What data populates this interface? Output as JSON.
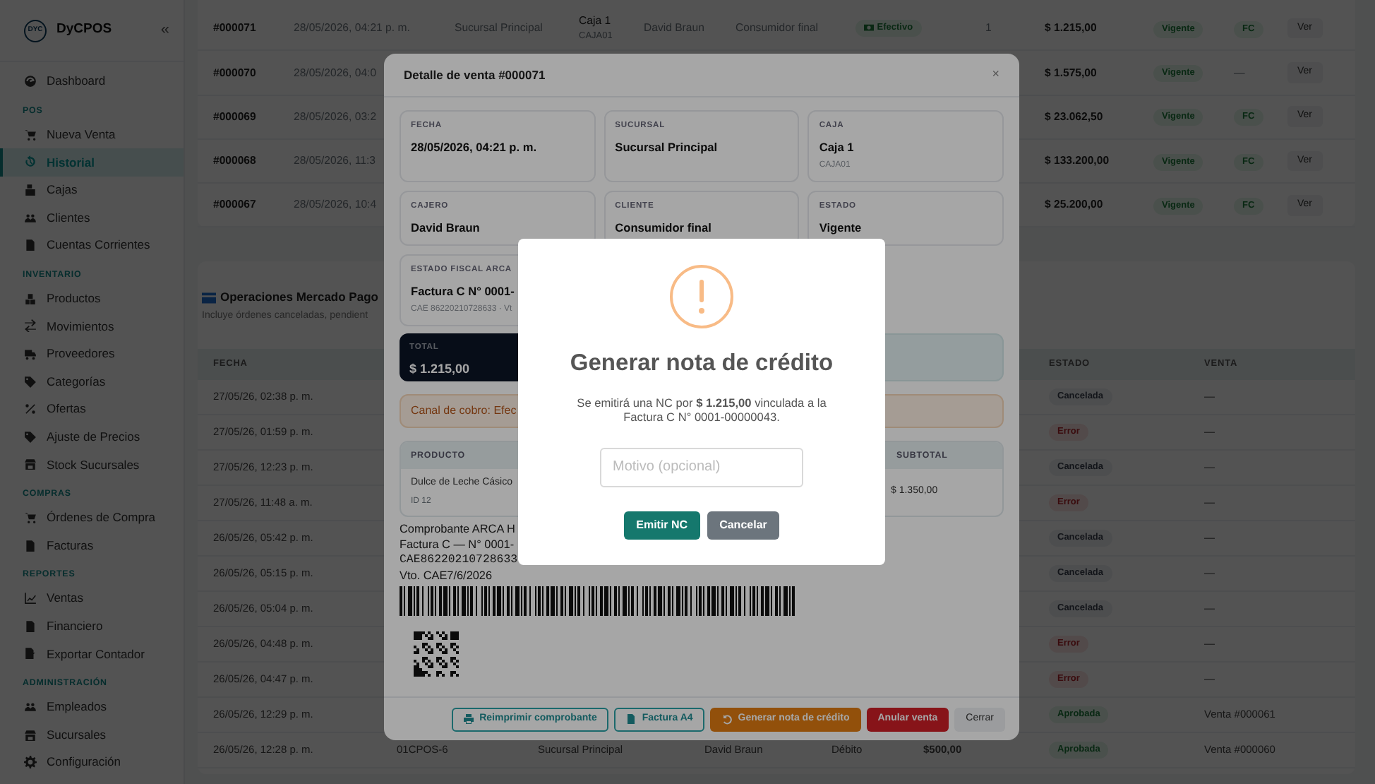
{
  "sidebar": {
    "brand": "DyCPOS",
    "logo_text": "DYC",
    "collapse": "«",
    "sections": [
      {
        "items": [
          {
            "label": "Dashboard",
            "selected": false
          }
        ]
      },
      {
        "title": "POS",
        "items": [
          {
            "label": "Nueva Venta",
            "selected": false
          },
          {
            "label": "Historial",
            "selected": true
          },
          {
            "label": "Cajas",
            "selected": false
          },
          {
            "label": "Clientes",
            "selected": false
          },
          {
            "label": "Cuentas Corrientes",
            "selected": false
          }
        ]
      },
      {
        "title": "INVENTARIO",
        "items": [
          {
            "label": "Productos",
            "selected": false
          },
          {
            "label": "Movimientos",
            "selected": false
          },
          {
            "label": "Proveedores",
            "selected": false
          },
          {
            "label": "Categorías",
            "selected": false
          },
          {
            "label": "Ofertas",
            "selected": false
          },
          {
            "label": "Ajuste de Precios",
            "selected": false
          },
          {
            "label": "Stock Sucursales",
            "selected": false
          }
        ]
      },
      {
        "title": "COMPRAS",
        "items": [
          {
            "label": "Órdenes de Compra",
            "selected": false
          },
          {
            "label": "Facturas",
            "selected": false
          }
        ]
      },
      {
        "title": "REPORTES",
        "items": [
          {
            "label": "Ventas",
            "selected": false
          },
          {
            "label": "Financiero",
            "selected": false
          },
          {
            "label": "Exportar Contador",
            "selected": false
          }
        ]
      },
      {
        "title": "ADMINISTRACIÓN",
        "items": [
          {
            "label": "Empleados",
            "selected": false
          },
          {
            "label": "Sucursales",
            "selected": false
          },
          {
            "label": "Configuración",
            "selected": false
          }
        ]
      }
    ]
  },
  "sales_table": {
    "rows": [
      {
        "id": "#000071",
        "date": "28/05/2026, 04:21 p. m.",
        "branch": "Sucursal Principal",
        "register": "Caja 1",
        "register_code": "CAJA01",
        "cashier": "David Braun",
        "customer": "Consumidor final",
        "payment": "Efectivo",
        "items": "1",
        "total": "$ 1.215,00",
        "status": "Vigente",
        "invoice": {
          "label": "FC",
          "kind": "badge"
        },
        "action": "Ver"
      },
      {
        "id": "#000070",
        "date": "28/05/2026, 04:0",
        "total": "$ 1.575,00",
        "status": "Vigente",
        "invoice": {
          "label": "—",
          "kind": "plain"
        },
        "action": "Ver"
      },
      {
        "id": "#000069",
        "date": "28/05/2026, 03:2",
        "total": "$ 23.062,50",
        "status": "Vigente",
        "invoice": {
          "label": "FC",
          "kind": "badge"
        },
        "action": "Ver"
      },
      {
        "id": "#000068",
        "date": "28/05/2026, 11:3",
        "total": "$ 133.200,00",
        "status": "Vigente",
        "invoice": {
          "label": "FC",
          "kind": "badge"
        },
        "action": "Ver"
      },
      {
        "id": "#000067",
        "date": "28/05/2026, 10:4",
        "total": "$ 25.200,00",
        "status": "Vigente",
        "invoice": {
          "label": "FC",
          "kind": "badge"
        },
        "action": "Ver"
      }
    ]
  },
  "mp_operations": {
    "title": "Operaciones Mercado Pago",
    "subtitle": "Incluye órdenes canceladas, pendient",
    "columns": {
      "date": "FECHA",
      "status": "ESTADO",
      "sale": "VENTA"
    },
    "rows": [
      {
        "date": "27/05/26, 02:38 p. m.",
        "status": {
          "label": "Cancelada",
          "kind": "cancelled"
        },
        "sale": "—"
      },
      {
        "date": "27/05/26, 01:59 p. m.",
        "status": {
          "label": "Error",
          "kind": "error"
        },
        "sale": "—"
      },
      {
        "date": "27/05/26, 12:23 p. m.",
        "status": {
          "label": "Cancelada",
          "kind": "cancelled"
        },
        "sale": "—"
      },
      {
        "date": "27/05/26, 11:48 a. m.",
        "status": {
          "label": "Error",
          "kind": "error"
        },
        "sale": "—"
      },
      {
        "date": "26/05/26, 05:42 p. m.",
        "status": {
          "label": "Cancelada",
          "kind": "cancelled"
        },
        "sale": "—"
      },
      {
        "date": "26/05/26, 05:15 p. m.",
        "status": {
          "label": "Cancelada",
          "kind": "cancelled"
        },
        "sale": "—"
      },
      {
        "date": "26/05/26, 05:04 p. m.",
        "status": {
          "label": "Cancelada",
          "kind": "cancelled"
        },
        "sale": "—"
      },
      {
        "date": "26/05/26, 04:48 p. m.",
        "status": {
          "label": "Error",
          "kind": "error"
        },
        "sale": "—"
      },
      {
        "date": "26/05/26, 04:47 p. m.",
        "status": {
          "label": "Error",
          "kind": "error"
        },
        "sale": "—"
      },
      {
        "date": "26/05/26, 12:29 p. m.",
        "status": {
          "label": "Aprobada",
          "kind": "approved"
        },
        "sale": "Venta #000061"
      },
      {
        "date": "26/05/26, 12:28 p. m.",
        "reference": "01CPOS-6",
        "branch": "Sucursal Principal",
        "cashier": "David Braun",
        "method": "Débito",
        "amount": "$500,00",
        "status": {
          "label": "Aprobada",
          "kind": "approved"
        },
        "sale": "Venta #000060"
      }
    ]
  },
  "sale_detail_modal": {
    "title": "Detalle de venta #000071",
    "close": "×",
    "fields": [
      {
        "label": "FECHA",
        "value": "28/05/2026, 04:21 p. m."
      },
      {
        "label": "SUCURSAL",
        "value": "Sucursal Principal"
      },
      {
        "label": "CAJA",
        "value": "Caja 1",
        "sub": "CAJA01"
      },
      {
        "label": "CAJERO",
        "value": "David Braun"
      },
      {
        "label": "CLIENTE",
        "value": "Consumidor final"
      },
      {
        "label": "ESTADO",
        "value": "Vigente"
      },
      {
        "label": "ESTADO FISCAL ARCA",
        "value": "Factura C N° 0001-",
        "sub": "CAE 86220210728633 · Vt"
      }
    ],
    "total": {
      "label": "TOTAL",
      "value": "$ 1.215,00"
    },
    "payment_alert": "Canal de cobro: Efec",
    "products": {
      "columns": {
        "product": "PRODUCTO",
        "subtotal": "SUBTOTAL"
      },
      "rows": [
        {
          "name": "Dulce de Leche Cásico",
          "id": "ID 12",
          "subtotal": "$ 1.350,00"
        }
      ]
    },
    "receipt_lines": [
      "Comprobante ARCA H",
      "Factura C — N° 0001-",
      "CAE86220210728633",
      "Vto. CAE7/6/2026"
    ],
    "buttons": [
      {
        "label": "Reimprimir comprobante",
        "kind": "print"
      },
      {
        "label": "Factura A4",
        "kind": "a4"
      },
      {
        "label": "Generar nota de crédito",
        "kind": "credit"
      },
      {
        "label": "Anular venta",
        "kind": "void"
      },
      {
        "label": "Cerrar",
        "kind": "close"
      }
    ]
  },
  "credit_note_dialog": {
    "title": "Generar nota de crédito",
    "message": "Se emitirá una NC por **$ 1.215,00** vinculada a la Factura C N° 0001-00000043.",
    "reason_field": {
      "placeholder": "Motivo (opcional)"
    },
    "buttons": [
      {
        "label": "Emitir NC",
        "kind": "confirm"
      },
      {
        "label": "Cancelar",
        "kind": "cancel"
      }
    ]
  }
}
